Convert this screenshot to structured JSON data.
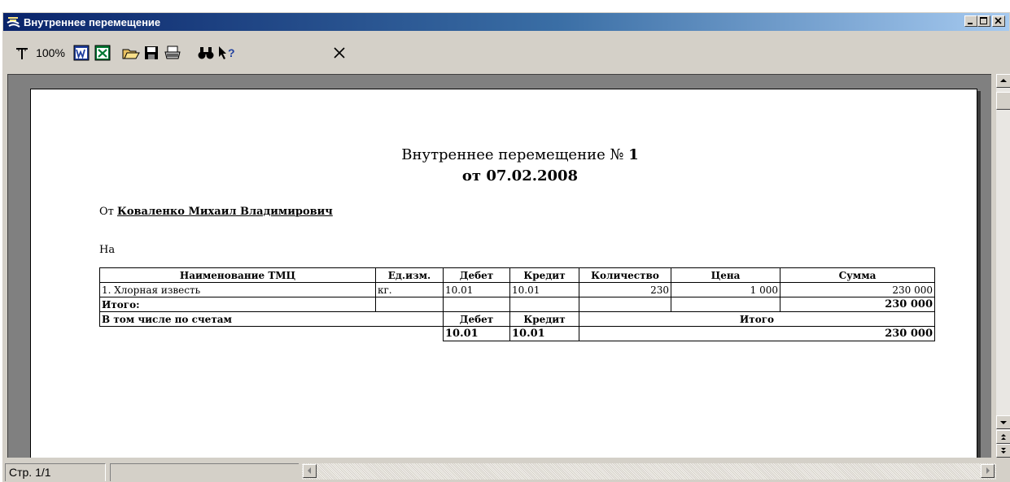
{
  "window": {
    "title": "Внутреннее перемещение"
  },
  "toolbar": {
    "zoom_label": "100%"
  },
  "document": {
    "title": "Внутреннее перемещение №",
    "number": "1",
    "date": "от 07.02.2008",
    "from_label": "От",
    "from_name": "Коваленко  Михаил  Владимирович",
    "to_label": "На",
    "table": {
      "headers": [
        "Наименование ТМЦ",
        "Ед.изм.",
        "Дебет",
        "Кредит",
        "Количество",
        "Цена",
        "Сумма"
      ],
      "rows": [
        [
          "1. Хлорная известь",
          "кг.",
          "10.01",
          "10.01",
          "230",
          "1 000",
          "230 000"
        ]
      ],
      "total_label": "Итого:",
      "total_sum": "230 000",
      "accounts_label": "В том числе по счетам",
      "accounts_debit_header": "Дебет",
      "accounts_credit_header": "Кредит",
      "accounts_total_header": "Итого",
      "accounts_debit": "10.01",
      "accounts_credit": "10.01",
      "accounts_sum": "230 000"
    }
  },
  "statusbar": {
    "page_indicator": "Стр. 1/1"
  }
}
